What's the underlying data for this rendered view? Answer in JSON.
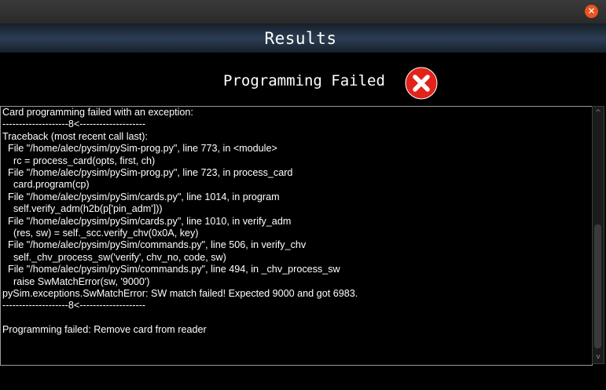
{
  "window": {
    "close_glyph": "✕"
  },
  "header": {
    "title": "Results"
  },
  "status": {
    "text": "Programming Failed",
    "icon": "error-x-icon",
    "icon_color": "#e2231a"
  },
  "log": {
    "lines": [
      "Card programming failed with an exception:",
      "--------------------8<--------------------",
      "Traceback (most recent call last):",
      "  File \"/home/alec/pysim/pySim-prog.py\", line 773, in <module>",
      "    rc = process_card(opts, first, ch)",
      "  File \"/home/alec/pysim/pySim-prog.py\", line 723, in process_card",
      "    card.program(cp)",
      "  File \"/home/alec/pysim/pySim/cards.py\", line 1014, in program",
      "    self.verify_adm(h2b(p['pin_adm']))",
      "  File \"/home/alec/pysim/pySim/cards.py\", line 1010, in verify_adm",
      "    (res, sw) = self._scc.verify_chv(0x0A, key)",
      "  File \"/home/alec/pysim/pySim/commands.py\", line 506, in verify_chv",
      "    self._chv_process_sw('verify', chv_no, code, sw)",
      "  File \"/home/alec/pysim/pySim/commands.py\", line 494, in _chv_process_sw",
      "    raise SwMatchError(sw, '9000')",
      "pySim.exceptions.SwMatchError: SW match failed! Expected 9000 and got 6983.",
      "--------------------8<--------------------",
      "",
      "Programming failed: Remove card from reader"
    ]
  },
  "scrollbar": {
    "up_glyph": "^",
    "down_glyph": "v"
  }
}
